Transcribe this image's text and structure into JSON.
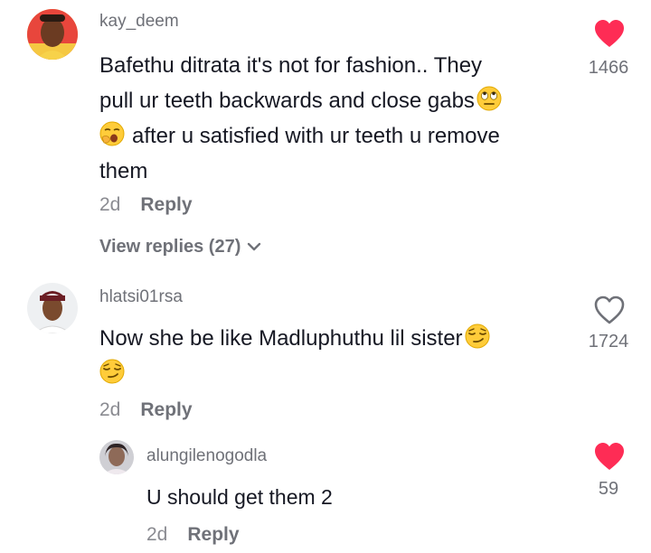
{
  "comments": [
    {
      "username": "kay_deem",
      "text_lines": [
        "Bafethu ditrata it's not for fashion.. They",
        "pull ur teeth backwards and close gabs",
        "after u satisfied with ur teeth u remove",
        "them"
      ],
      "time": "2d",
      "reply_label": "Reply",
      "view_replies": "View replies (27)",
      "likes": "1466",
      "liked": true
    },
    {
      "username": "hlatsi01rsa",
      "text_lines": [
        "Now she be like Madluphuthu lil sister"
      ],
      "time": "2d",
      "reply_label": "Reply",
      "likes": "1724",
      "liked": false,
      "replies": [
        {
          "username": "alungilenogodla",
          "text": "U should get them 2",
          "time": "2d",
          "reply_label": "Reply",
          "likes": "59",
          "liked": true
        }
      ]
    }
  ],
  "colors": {
    "like_red": "#fe2c55",
    "text": "#161823",
    "muted": "#6f7178"
  },
  "icons": [
    "heart-filled-icon",
    "heart-outline-icon",
    "chevron-down-icon",
    "rolling-eyes-emoji",
    "yawning-face-emoji",
    "smirking-face-emoji"
  ]
}
